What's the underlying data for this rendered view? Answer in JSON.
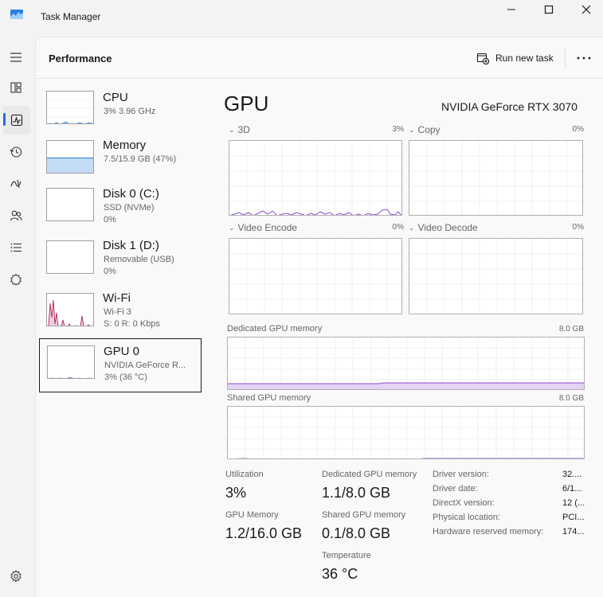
{
  "window": {
    "title": "Task Manager",
    "icon": "task-manager-icon",
    "controls": [
      "minimize-icon",
      "maximize-icon",
      "close-icon"
    ]
  },
  "nav": {
    "items": [
      {
        "name": "hamburger-menu-icon"
      },
      {
        "name": "processes-icon"
      },
      {
        "name": "performance-icon",
        "active": true
      },
      {
        "name": "app-history-icon"
      },
      {
        "name": "startup-apps-icon"
      },
      {
        "name": "users-icon"
      },
      {
        "name": "details-icon"
      },
      {
        "name": "services-icon"
      }
    ],
    "settings_icon": "gear-icon"
  },
  "header": {
    "title": "Performance",
    "run_new_task": "Run new task",
    "more_icon": "more-options-icon"
  },
  "devices": [
    {
      "name": "CPU",
      "line1": "3%  3.96 GHz",
      "line2": "",
      "color": "#1f7bd6"
    },
    {
      "name": "Memory",
      "line1": "7.5/15.9 GB (47%)",
      "line2": "",
      "color": "#1f7bd6",
      "fill_level": 0.47
    },
    {
      "name": "Disk 0 (C:)",
      "line1": "SSD (NVMe)",
      "line2": "0%",
      "color": "#4da14d"
    },
    {
      "name": "Disk 1 (D:)",
      "line1": "Removable (USB)",
      "line2": "0%",
      "color": "#4da14d"
    },
    {
      "name": "Wi-Fi",
      "line1": "Wi-Fi 3",
      "line2": "S: 0  R: 0 Kbps",
      "color": "#b0245f"
    },
    {
      "name": "GPU 0",
      "line1": "NVIDIA GeForce R...",
      "line2": "3%  (36 °C)",
      "color": "#8a4bd1",
      "selected": true
    }
  ],
  "gpu": {
    "title": "GPU",
    "model": "NVIDIA GeForce RTX 3070",
    "accent": "#8a4bd1",
    "engines": [
      {
        "label": "3D",
        "percent": "3%"
      },
      {
        "label": "Copy",
        "percent": "0%"
      },
      {
        "label": "Video Encode",
        "percent": "0%"
      },
      {
        "label": "Video Decode",
        "percent": "0%"
      }
    ],
    "dedicated_label": "Dedicated GPU memory",
    "dedicated_cap": "8.0 GB",
    "shared_label": "Shared GPU memory",
    "shared_cap": "8.0 GB"
  },
  "stats": {
    "utilization_label": "Utilization",
    "utilization_value": "3%",
    "dedicated_mem_label": "Dedicated GPU memory",
    "dedicated_mem_value": "1.1/8.0 GB",
    "gpu_memory_label": "GPU Memory",
    "gpu_memory_value": "1.2/16.0 GB",
    "shared_mem_label": "Shared GPU memory",
    "shared_mem_value": "0.1/8.0 GB",
    "temperature_label": "Temperature",
    "temperature_value": "36 °C"
  },
  "details": [
    {
      "label": "Driver version:",
      "value": "32...."
    },
    {
      "label": "Driver date:",
      "value": "6/1..."
    },
    {
      "label": "DirectX version:",
      "value": "12 (..."
    },
    {
      "label": "Physical location:",
      "value": "PCI..."
    },
    {
      "label": "Hardware reserved memory:",
      "value": "174..."
    }
  ]
}
